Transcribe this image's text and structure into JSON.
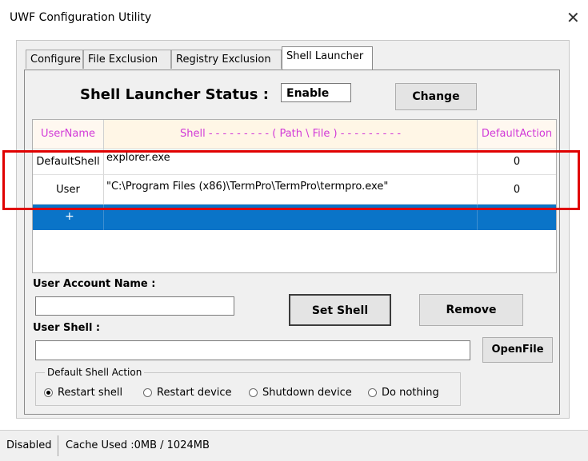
{
  "window": {
    "title": "UWF Configuration Utility",
    "close_glyph": "✕"
  },
  "tabs": [
    {
      "label": "Configure"
    },
    {
      "label": "File Exclusion"
    },
    {
      "label": "Registry Exclusion"
    },
    {
      "label": "Shell Launcher",
      "active": true
    }
  ],
  "status": {
    "label": "Shell Launcher Status :",
    "value": "Enable",
    "change_label": "Change"
  },
  "grid": {
    "headers": [
      "UserName",
      "Shell  - - - - - - - - - ( Path \\ File ) - - - - - - - - -",
      "DefaultAction"
    ],
    "rows": [
      {
        "username": "DefaultShell",
        "shell": "explorer.exe",
        "action": "0"
      },
      {
        "username": "User",
        "shell": "\"C:\\Program Files (x86)\\TermPro\\TermPro\\termpro.exe\"",
        "action": "0"
      }
    ],
    "new_row_marker": "+"
  },
  "form": {
    "user_account_label": "User Account Name :",
    "user_account_value": "",
    "user_shell_label": "User Shell :",
    "user_shell_value": "",
    "set_shell_label": "Set Shell",
    "remove_label": "Remove",
    "openfile_label": "OpenFile",
    "default_action_title": "Default Shell Action",
    "options": [
      "Restart shell",
      "Restart device",
      "Shutdown device",
      "Do nothing"
    ],
    "selected_option": "Restart shell"
  },
  "statusbar": {
    "state": "Disabled",
    "cache": "Cache Used :0MB / 1024MB"
  },
  "colors": {
    "header_text": "#d23ad8",
    "selection": "#0a74c8",
    "highlight_box": "#e00000"
  }
}
